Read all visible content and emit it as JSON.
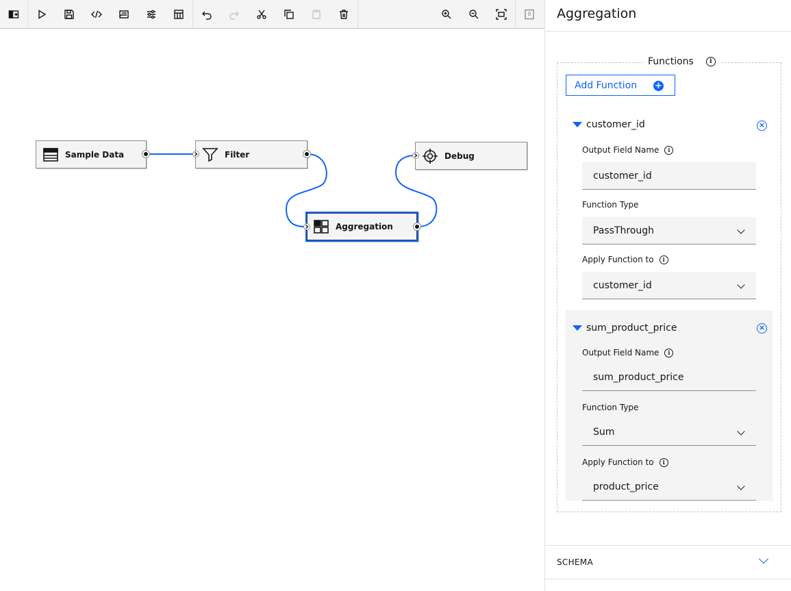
{
  "toolbar": {
    "buttons": [
      {
        "name": "toggle-palette-button",
        "icon": "sidebar-toggle-icon"
      },
      {
        "name": "run-button",
        "icon": "play-icon"
      },
      {
        "name": "save-button",
        "icon": "save-icon"
      },
      {
        "name": "code-button",
        "icon": "code-icon"
      },
      {
        "name": "settings-list-button",
        "icon": "list-settings-icon"
      },
      {
        "name": "adjust-button",
        "icon": "sliders-icon"
      },
      {
        "name": "schedule-button",
        "icon": "calendar-icon"
      },
      {
        "name": "undo-button",
        "icon": "undo-icon"
      },
      {
        "name": "redo-button",
        "icon": "redo-icon",
        "disabled": true
      },
      {
        "name": "cut-button",
        "icon": "cut-icon"
      },
      {
        "name": "copy-button",
        "icon": "copy-icon"
      },
      {
        "name": "paste-button",
        "icon": "paste-icon",
        "disabled": true
      },
      {
        "name": "delete-button",
        "icon": "trash-icon"
      },
      {
        "name": "zoom-in-button",
        "icon": "zoom-in-icon"
      },
      {
        "name": "zoom-out-button",
        "icon": "zoom-out-icon"
      },
      {
        "name": "fit-to-screen-button",
        "icon": "fit-screen-icon"
      },
      {
        "name": "notifications-button",
        "icon": "notification-counter-icon",
        "badge": "0"
      }
    ]
  },
  "canvas": {
    "nodes": [
      {
        "id": "sample-data",
        "label": "Sample Data",
        "icon": "data-table-icon"
      },
      {
        "id": "filter",
        "label": "Filter",
        "icon": "filter-icon"
      },
      {
        "id": "aggregation",
        "label": "Aggregation",
        "icon": "aggregation-icon",
        "selected": true
      },
      {
        "id": "debug",
        "label": "Debug",
        "icon": "crosshair-icon"
      }
    ],
    "link_color": "#0f62fe"
  },
  "panel": {
    "title": "Aggregation",
    "functions_legend": "Functions",
    "add_function_label": "Add Function",
    "functions": [
      {
        "name": "customer_id",
        "output_field_label": "Output Field Name",
        "output_field_value": "customer_id",
        "function_type_label": "Function Type",
        "function_type_value": "PassThrough",
        "apply_to_label": "Apply Function to",
        "apply_to_value": "customer_id"
      },
      {
        "name": "sum_product_price",
        "output_field_label": "Output Field Name",
        "output_field_value": "sum_product_price",
        "function_type_label": "Function Type",
        "function_type_value": "Sum",
        "apply_to_label": "Apply Function to",
        "apply_to_value": "product_price"
      }
    ],
    "schema_label": "SCHEMA"
  },
  "colors": {
    "accent": "#0f62fe",
    "toolbar_bg": "#f4f4f4",
    "field_bg": "#f4f4f4"
  }
}
